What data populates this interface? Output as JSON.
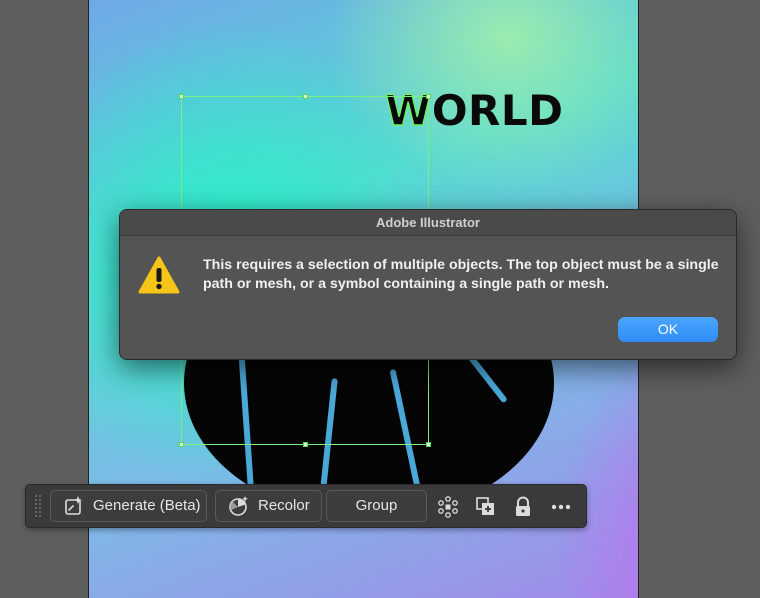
{
  "canvas": {
    "artboard_text": "WORLD",
    "world_first_letter": "W",
    "world_rest": "ORLD"
  },
  "dialog": {
    "title": "Adobe Illustrator",
    "icon": "warning-triangle-icon",
    "message": "This requires a selection of multiple objects. The top object must be a single path or mesh, or a symbol containing a single path or mesh.",
    "ok_label": "OK",
    "accent": "#3d9bff"
  },
  "taskbar": {
    "generate_label": "Generate (Beta)",
    "recolor_label": "Recolor",
    "group_label": "Group",
    "icons": [
      "generate-icon",
      "recolor-icon",
      "isolate-icon",
      "duplicate-icon",
      "lock-icon",
      "more-icon"
    ]
  },
  "colors": {
    "selection": "#7cf07c",
    "warning": "#f5c518",
    "ok_button": "#3d9bff"
  }
}
